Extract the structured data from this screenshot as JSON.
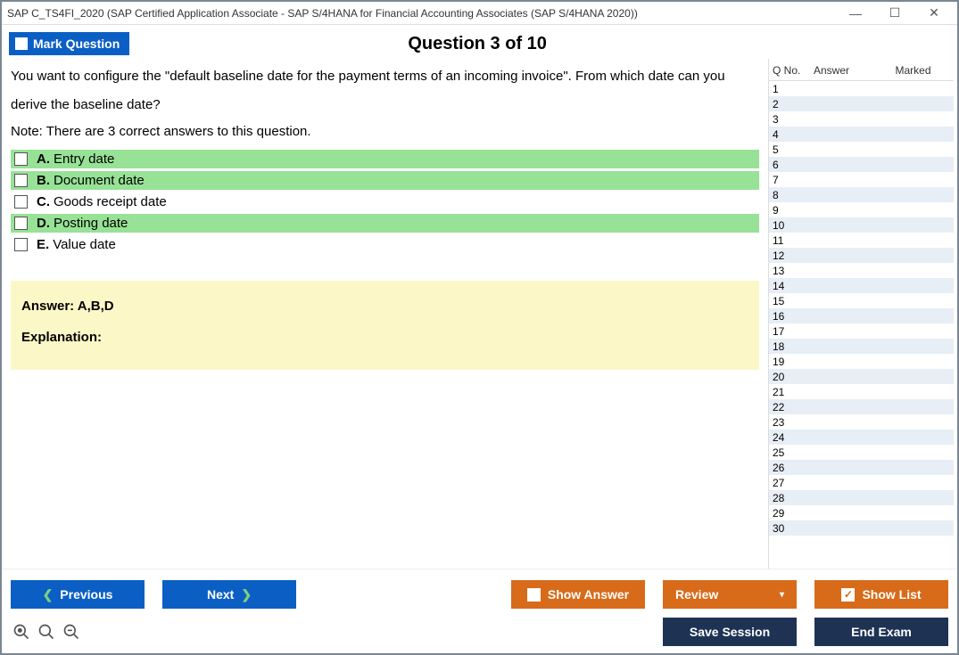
{
  "window": {
    "title": "SAP C_TS4FI_2020 (SAP Certified Application Associate - SAP S/4HANA for Financial Accounting Associates (SAP S/4HANA 2020))"
  },
  "header": {
    "mark_label": "Mark Question",
    "question_heading": "Question 3 of 10"
  },
  "question": {
    "text": "You want to configure the \"default baseline date for the payment terms of an incoming invoice\". From which date can you derive the baseline date?",
    "note": "Note: There are 3 correct answers to this question.",
    "options": [
      {
        "letter": "A.",
        "text": "Entry date",
        "correct": true
      },
      {
        "letter": "B.",
        "text": "Document date",
        "correct": true
      },
      {
        "letter": "C.",
        "text": "Goods receipt date",
        "correct": false
      },
      {
        "letter": "D.",
        "text": "Posting date",
        "correct": true
      },
      {
        "letter": "E.",
        "text": "Value date",
        "correct": false
      }
    ],
    "answer_line": "Answer: A,B,D",
    "explanation_label": "Explanation:"
  },
  "side": {
    "col_qno": "Q No.",
    "col_answer": "Answer",
    "col_marked": "Marked",
    "row_count": 30
  },
  "buttons": {
    "previous": "Previous",
    "next": "Next",
    "show_answer": "Show Answer",
    "review": "Review",
    "show_list": "Show List",
    "save_session": "Save Session",
    "end_exam": "End Exam"
  }
}
